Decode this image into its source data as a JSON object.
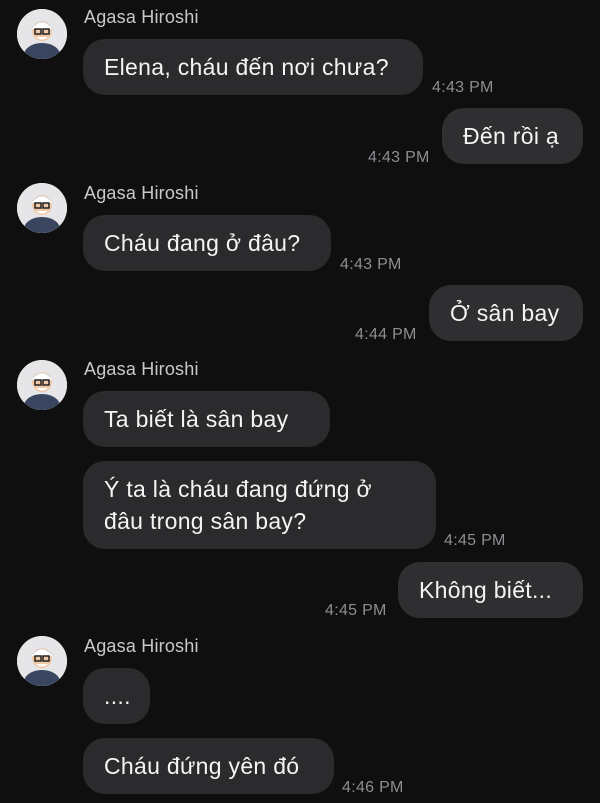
{
  "conversation": {
    "groups": [
      {
        "sender": "Agasa Hiroshi",
        "messages": [
          {
            "text": "Elena, cháu đến nơi chưa?",
            "time": "4:43 PM"
          }
        ]
      },
      {
        "mine": true,
        "messages": [
          {
            "text": "Đến rồi ạ",
            "time": "4:43 PM"
          }
        ]
      },
      {
        "sender": "Agasa Hiroshi",
        "messages": [
          {
            "text": "Cháu đang ở đâu?",
            "time": "4:43 PM"
          }
        ]
      },
      {
        "mine": true,
        "messages": [
          {
            "text": "Ở sân bay",
            "time": "4:44 PM"
          }
        ]
      },
      {
        "sender": "Agasa Hiroshi",
        "messages": [
          {
            "text": "Ta biết là sân bay"
          },
          {
            "text": "Ý ta là cháu đang đứng ở đâu trong sân bay?",
            "time": "4:45 PM"
          }
        ]
      },
      {
        "mine": true,
        "messages": [
          {
            "text": "Không biết...",
            "time": "4:45 PM"
          }
        ]
      },
      {
        "sender": "Agasa Hiroshi",
        "messages": [
          {
            "text": "...."
          },
          {
            "text": "Cháu đứng yên đó",
            "time": "4:46 PM"
          }
        ]
      }
    ]
  },
  "colors": {
    "background": "#0f0f10",
    "bubble": "#2b2b2e",
    "timestamp": "#8d8d92",
    "sender": "#c9c9cc"
  },
  "icons": {
    "avatar": "old-man-avatar-icon"
  }
}
